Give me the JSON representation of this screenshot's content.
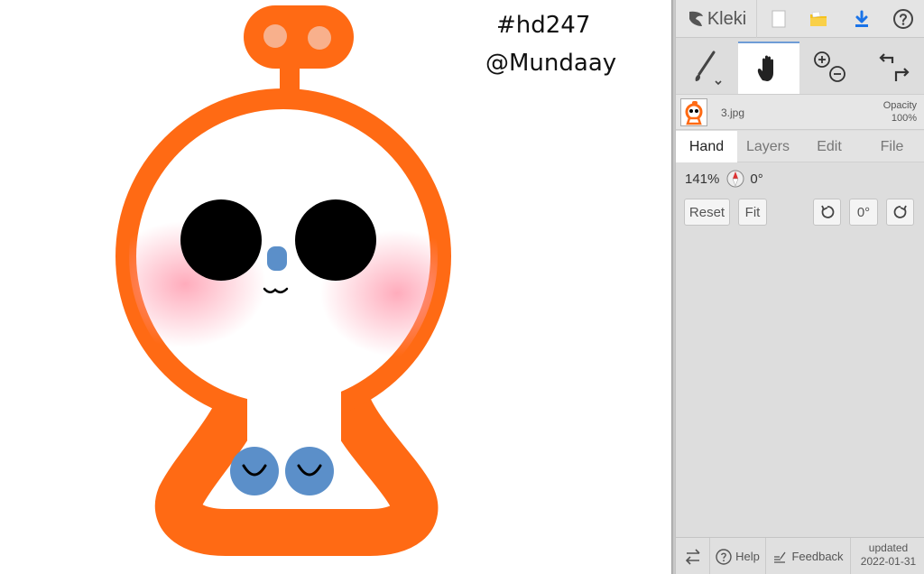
{
  "canvas": {
    "text_line1": "#hd247",
    "text_line2": "@Mundaay",
    "colors": {
      "orange": "#ff6a14",
      "light_orange": "#f8b08c",
      "blush": "#ff9db0",
      "blue": "#5b8fc9",
      "black": "#000000"
    }
  },
  "panel": {
    "logo": "Kleki",
    "top_icons": [
      "kleki-logo-icon",
      "new-image-icon",
      "open-folder-icon",
      "save-download-icon",
      "help-circle-icon"
    ],
    "tools": [
      "brush-icon",
      "hand-icon",
      "zoom-in-icon",
      "zoom-out-icon",
      "undo-icon",
      "redo-icon"
    ],
    "layer": {
      "name": "3.jpg",
      "opacity_label": "Opacity",
      "opacity_value": "100%"
    },
    "tabs": [
      {
        "label": "Hand",
        "active": true
      },
      {
        "label": "Layers",
        "active": false
      },
      {
        "label": "Edit",
        "active": false
      },
      {
        "label": "File",
        "active": false
      }
    ],
    "hand": {
      "zoom": "141%",
      "angle": "0°",
      "reset_label": "Reset",
      "fit_label": "Fit",
      "rotate_zero_label": "0°"
    },
    "bottom": {
      "help_label": "Help",
      "feedback_label": "Feedback",
      "updated_label": "updated",
      "updated_date": "2022-01-31"
    },
    "accent_color": "#6e9cd6",
    "save_icon_color": "#1a73e8",
    "folder_color": "#f6c21c"
  }
}
